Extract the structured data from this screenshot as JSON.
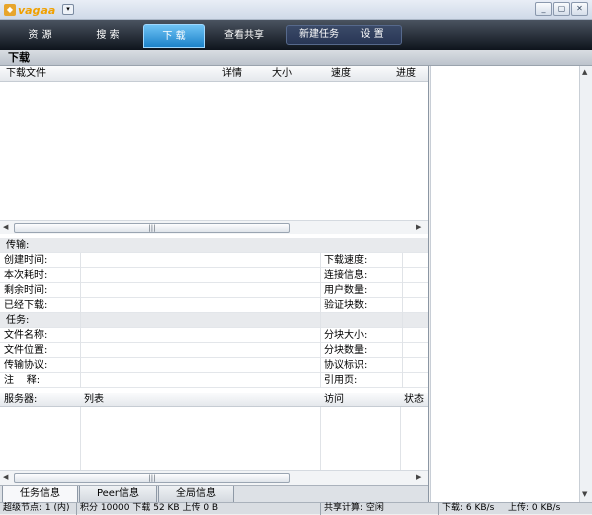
{
  "app": {
    "logo_text": "vagaa",
    "menu_glyph": "▾"
  },
  "window_buttons": {
    "minimize": "_",
    "restore": "▢",
    "close": "✕"
  },
  "tabs": {
    "resources": "资 源",
    "search": "搜 索",
    "download": "下 载",
    "view_share": "查看共享",
    "new_task": "新建任务",
    "settings": "设 置"
  },
  "section_title": "下载",
  "download_columns": {
    "file": "下载文件",
    "detail": "详情",
    "size": "大小",
    "speed": "速度",
    "progress": "进度"
  },
  "scroll_glyphs": {
    "left": "◀",
    "right": "▶",
    "up": "▲",
    "down": "▼",
    "grip": "|||"
  },
  "info": {
    "transfer_group": "传输:",
    "created": "创建时间:",
    "elapsed": "本次耗时:",
    "remaining": "剩余时间:",
    "downloaded": "已经下载:",
    "dl_speed": "下载速度:",
    "connection": "连接信息:",
    "users": "用户数量:",
    "verified": "验证块数:",
    "task_group": "任务:",
    "file_name": "文件名称:",
    "file_location": "文件位置:",
    "protocol": "传输协议:",
    "note": "注    释:",
    "block_size": "分块大小:",
    "block_count": "分块数量:",
    "protocol_id": "协议标识:",
    "referer": "引用页:"
  },
  "server_columns": {
    "server": "服务器:",
    "list": "列表",
    "access": "访问",
    "status": "状态"
  },
  "bottom_tabs": {
    "task_info": "任务信息",
    "peer_info": "Peer信息",
    "global_info": "全局信息"
  },
  "status": {
    "super_nodes": "超级节点: 1 (内)",
    "points": "积分 10000 下载 52 KB 上传 0 B",
    "share": "共享计算: 空闲",
    "down": "下载: 6 KB/s",
    "up": "上传: 0 KB/s"
  }
}
